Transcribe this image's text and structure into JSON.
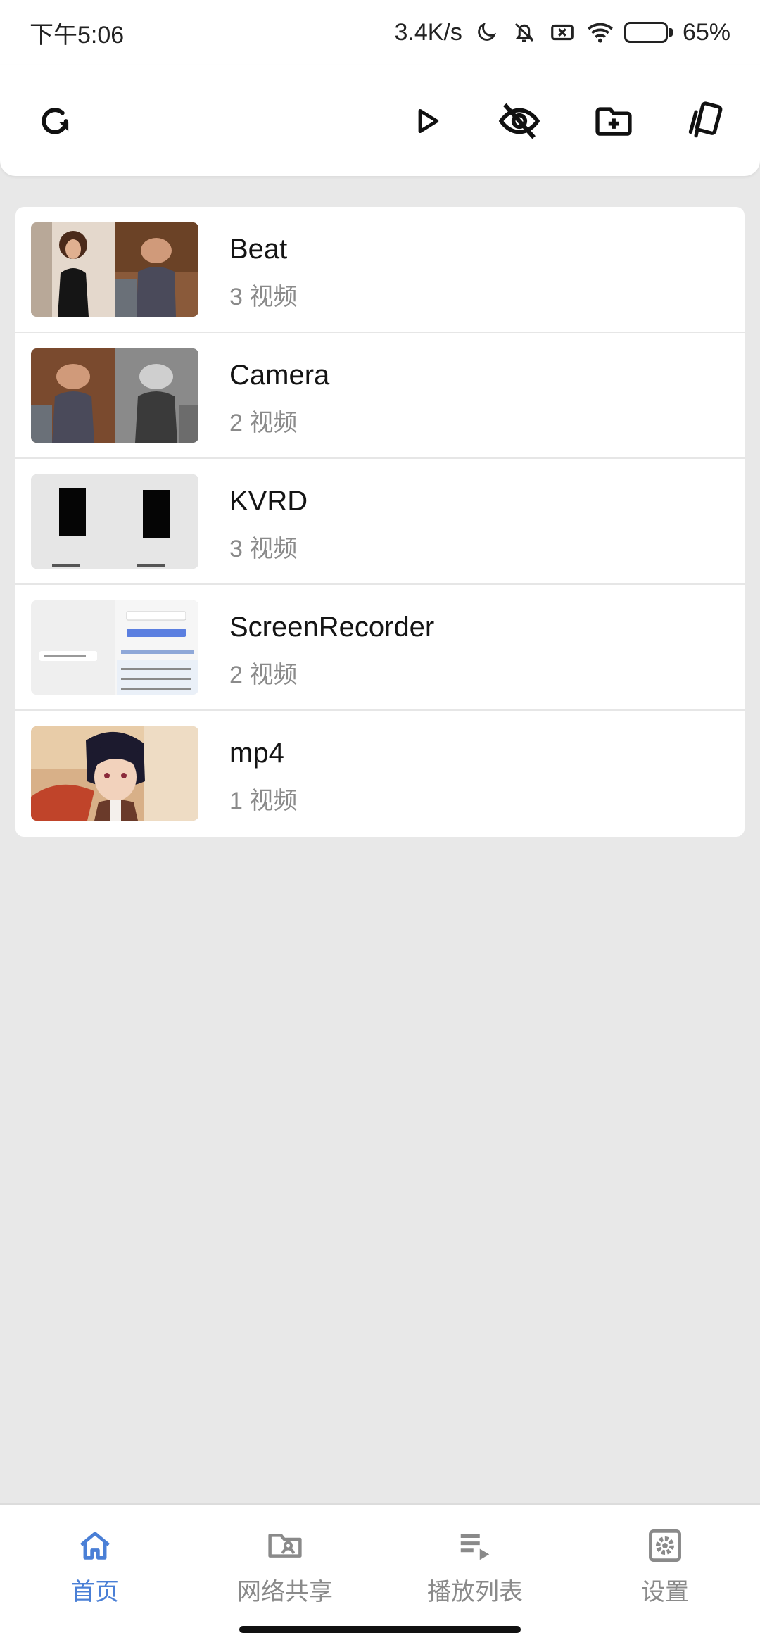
{
  "status_bar": {
    "time": "下午5:06",
    "net_speed": "3.4K/s",
    "battery_percent": "65%",
    "battery_level": 0.65,
    "icons": [
      "moon-icon",
      "bell-off-icon",
      "sim-off-icon",
      "wifi-icon",
      "battery-icon"
    ]
  },
  "toolbar": {
    "left_icon": "refresh-icon",
    "right_icons": [
      "play-icon",
      "eye-off-icon",
      "folder-add-icon",
      "cards-icon"
    ]
  },
  "folders": [
    {
      "name": "Beat",
      "count": "3 视频"
    },
    {
      "name": "Camera",
      "count": "2 视频"
    },
    {
      "name": "KVRD",
      "count": "3 视频"
    },
    {
      "name": "ScreenRecorder",
      "count": "2 视频"
    },
    {
      "name": "mp4",
      "count": "1 视频"
    }
  ],
  "bottom_nav": {
    "items": [
      {
        "label": "首页",
        "icon": "home-icon",
        "active": true
      },
      {
        "label": "网络共享",
        "icon": "folder-person-icon",
        "active": false
      },
      {
        "label": "播放列表",
        "icon": "playlist-icon",
        "active": false
      },
      {
        "label": "设置",
        "icon": "settings-icon",
        "active": false
      }
    ]
  },
  "colors": {
    "accent": "#4a7fd6",
    "background": "#e8e8e8",
    "battery": "#f0b429"
  }
}
